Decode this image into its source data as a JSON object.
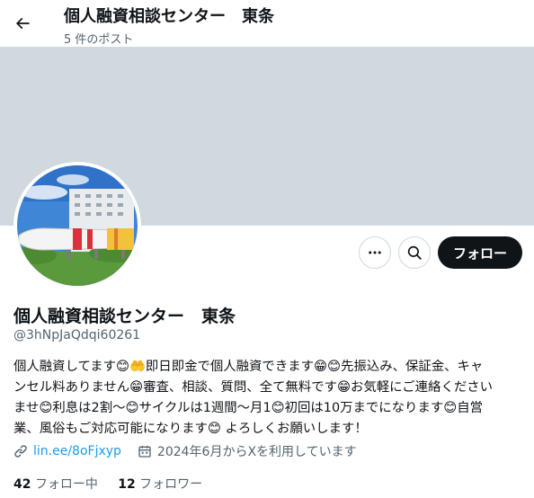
{
  "header": {
    "title": "個人融資相談センター　東条",
    "post_count": "5 件のポスト"
  },
  "profile": {
    "name": "個人融資相談センター　東条",
    "handle": "@3hNpJaQdqi60261",
    "follow_label": "フォロー",
    "bio_lines": [
      [
        "個人融資してます",
        "😊🤲",
        "即日即金で個人融資できます",
        "😁😊",
        "先振込み、保証金、キャ"
      ],
      [
        "ンセル料ありません",
        "😁",
        "審査、相談、質問、全て無料です",
        "😁",
        "お気軽にご連絡くださ",
        "い"
      ],
      [
        "ませ",
        "😊",
        "利息は2割～",
        "😊",
        "サイクルは1週間～月1",
        "😊",
        "初回は10万までになります",
        "😊",
        "自営"
      ],
      [
        "業、風俗もご対応可能になります",
        "😊",
        " よろしくお願いします！"
      ]
    ],
    "link": "lin.ee/8oFjxyp",
    "joined": "2024年6月からXを利用しています",
    "following_count": "42",
    "following_label": "フォロー中",
    "followers_count": "12",
    "followers_label": "フォロワー"
  },
  "icons": {
    "back": "arrow-left-icon",
    "more": "more-dots-icon",
    "search": "search-icon",
    "link": "link-icon",
    "calendar": "calendar-icon"
  },
  "colors": {
    "banner": "#cfd9de",
    "accent": "#1d9bf0",
    "primary_button": "#0f1419",
    "secondary_text": "#536471"
  }
}
